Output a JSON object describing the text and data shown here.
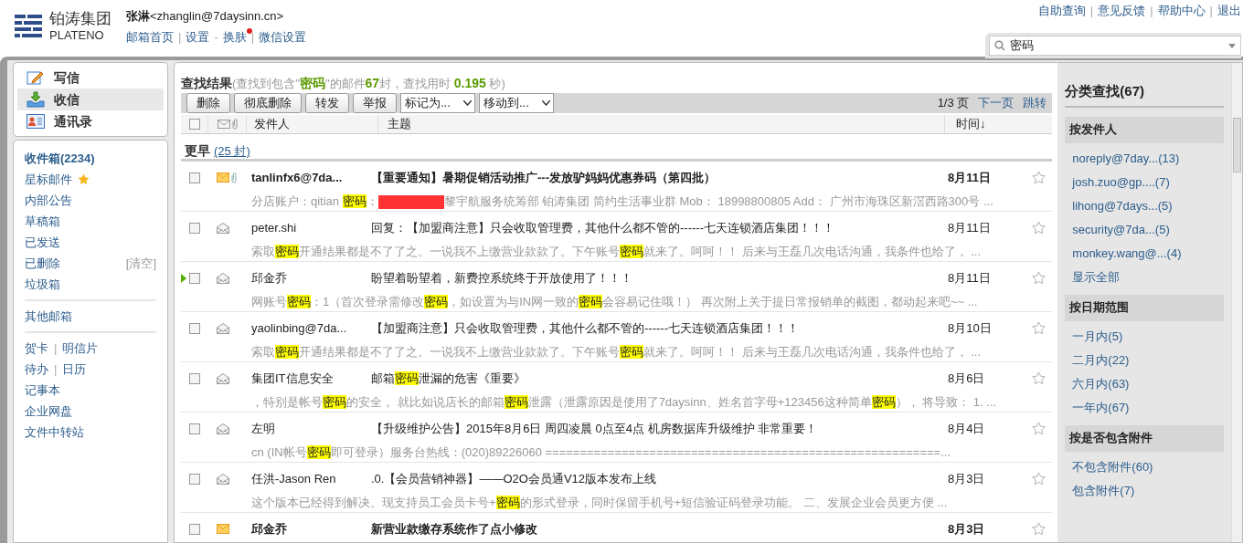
{
  "header": {
    "brand_cn": "铂涛集团",
    "brand_en": "PLATENO",
    "user_name": "张淋",
    "user_email": "<zhanglin@7daysinn.cn>",
    "links": [
      {
        "kind": "link",
        "label": "邮箱首页",
        "badge": false
      },
      {
        "kind": "separator",
        "label": "|"
      },
      {
        "kind": "link",
        "label": "设置",
        "badge": false
      },
      {
        "kind": "separator",
        "label": "-"
      },
      {
        "kind": "link",
        "label": "换肤",
        "badge": true
      },
      {
        "kind": "separator",
        "label": "|"
      },
      {
        "kind": "link",
        "label": "微信设置",
        "badge": false
      }
    ],
    "top_links": [
      {
        "kind": "link",
        "label": "自助查询"
      },
      {
        "kind": "separator",
        "label": "|"
      },
      {
        "kind": "link",
        "label": "意见反馈"
      },
      {
        "kind": "separator",
        "label": "|"
      },
      {
        "kind": "link",
        "label": "帮助中心"
      },
      {
        "kind": "separator",
        "label": "|"
      },
      {
        "kind": "link",
        "label": "退出"
      }
    ],
    "search": {
      "value": "密码"
    }
  },
  "nav": [
    {
      "label": "写信",
      "kind": "compose",
      "selected": false
    },
    {
      "label": "收信",
      "kind": "inbox",
      "selected": true
    },
    {
      "label": "通讯录",
      "kind": "contacts",
      "selected": false
    }
  ],
  "folder_groups": [
    [
      {
        "label": "收件箱(2234)",
        "kind": "bold"
      },
      {
        "label": "星标邮件",
        "kind": "starred"
      },
      {
        "label": "内部公告",
        "kind": "plain"
      },
      {
        "label": "草稿箱",
        "kind": "plain"
      },
      {
        "label": "已发送",
        "kind": "plain"
      },
      {
        "label": "已删除",
        "kind": "plain",
        "action": "[清空]"
      },
      {
        "label": "垃圾箱",
        "kind": "plain"
      }
    ],
    [
      {
        "label": "其他邮箱",
        "kind": "plain"
      }
    ],
    [
      {
        "links": [
          {
            "kind": "link",
            "label": "贺卡"
          },
          {
            "kind": "separator",
            "label": "|"
          },
          {
            "kind": "link",
            "label": "明信片"
          }
        ]
      },
      {
        "links": [
          {
            "kind": "link",
            "label": "待办"
          },
          {
            "kind": "separator",
            "label": "|"
          },
          {
            "kind": "link",
            "label": "日历"
          }
        ]
      },
      {
        "label": "记事本",
        "kind": "plain"
      },
      {
        "label": "企业网盘",
        "kind": "plain"
      },
      {
        "label": "文件中转站",
        "kind": "plain"
      }
    ]
  ],
  "results": {
    "title": "查找结果",
    "summary": "(查找到包含\"**密码**\"的邮件**67**封，查找用时 **0.195** 秒)"
  },
  "toolbar": {
    "buttons": [
      "删除",
      "彻底删除",
      "转发",
      "举报"
    ],
    "dropdowns": [
      "标记为...",
      "移动到..."
    ],
    "page": "1/3 页",
    "next": "下一页",
    "jump": "跳转"
  },
  "select_all": {
    "checked": false
  },
  "columns": [
    "发件人",
    "主题",
    "时间↓"
  ],
  "group": {
    "label": "更早",
    "count": "(25 封)"
  },
  "rows": [
    {
      "checked": false,
      "unread": true,
      "attachment": true,
      "current": false,
      "starred": false,
      "sender": "tanlinfx6@7da...",
      "subject": [
        {
          "text": "【重要通知】暑期促销活动推广---发放驴妈妈优惠券码（第四批）",
          "kind": "text"
        }
      ],
      "date": "8月11日",
      "preview": [
        {
          "text": "分店账户：qitian ",
          "kind": "text"
        },
        {
          "text": "密码",
          "kind": "highlight"
        },
        {
          "text": "：",
          "kind": "text"
        },
        {
          "kind": "redaction"
        },
        {
          "text": "黎宇航服务统筹部 铂涛集团 简约生活事业群 Mob： 18998800805 Add： 广州市海珠区新滘西路300号 ...",
          "kind": "text"
        }
      ]
    },
    {
      "checked": false,
      "unread": false,
      "attachment": false,
      "current": false,
      "starred": false,
      "sender": "peter.shi",
      "subject": [
        {
          "text": "回复：【加盟商注意】只会收取管理费，其他什么都不管的------七天连锁酒店集团！！！",
          "kind": "text"
        }
      ],
      "date": "8月11日",
      "preview": [
        {
          "text": "索取",
          "kind": "text"
        },
        {
          "text": "密码",
          "kind": "highlight"
        },
        {
          "text": "开通结果都是不了了之。一说我不上缴营业款款了。下午账号",
          "kind": "text"
        },
        {
          "text": "密码",
          "kind": "highlight"
        },
        {
          "text": "就来了。呵呵！！ 后来与王磊几次电话沟通，我条件也给了， ...",
          "kind": "text"
        }
      ]
    },
    {
      "checked": false,
      "unread": false,
      "attachment": false,
      "current": true,
      "starred": false,
      "sender": "邱金乔",
      "subject": [
        {
          "text": "盼望着盼望着，新费控系统终于开放使用了！！！",
          "kind": "text"
        }
      ],
      "date": "8月11日",
      "preview": [
        {
          "text": "网账号",
          "kind": "text"
        },
        {
          "text": "密码",
          "kind": "highlight"
        },
        {
          "text": "：1（首次登录需修改",
          "kind": "text"
        },
        {
          "text": "密码",
          "kind": "highlight"
        },
        {
          "text": "，如设置为与IN网一致的",
          "kind": "text"
        },
        {
          "text": "密码",
          "kind": "highlight"
        },
        {
          "text": "会容易记住哦！） 再次附上关于提日常报销单的截图，都动起来吧~~ ...",
          "kind": "text"
        }
      ]
    },
    {
      "checked": false,
      "unread": false,
      "attachment": false,
      "current": false,
      "starred": false,
      "sender": "yaolinbing@7da...",
      "subject": [
        {
          "text": "【加盟商注意】只会收取管理费，其他什么都不管的------七天连锁酒店集团！！！",
          "kind": "text"
        }
      ],
      "date": "8月10日",
      "preview": [
        {
          "text": "索取",
          "kind": "text"
        },
        {
          "text": "密码",
          "kind": "highlight"
        },
        {
          "text": "开通结果都是不了了之。一说我不上缴营业款款了。下午账号",
          "kind": "text"
        },
        {
          "text": "密码",
          "kind": "highlight"
        },
        {
          "text": "就来了。呵呵！！ 后来与王磊几次电话沟通，我条件也给了， ...",
          "kind": "text"
        }
      ]
    },
    {
      "checked": false,
      "unread": false,
      "attachment": false,
      "current": false,
      "starred": false,
      "sender": "集团IT信息安全",
      "subject": [
        {
          "text": "邮箱",
          "kind": "text"
        },
        {
          "text": "密码",
          "kind": "highlight"
        },
        {
          "text": "泄漏的危害《重要》",
          "kind": "text"
        }
      ],
      "date": "8月6日",
      "preview": [
        {
          "text": "，特别是帐号",
          "kind": "text"
        },
        {
          "text": "密码",
          "kind": "highlight"
        },
        {
          "text": "的安全， 就比如说店长的邮箱",
          "kind": "text"
        },
        {
          "text": "密码",
          "kind": "highlight"
        },
        {
          "text": "泄露（泄露原因是使用了7daysinn、姓名首字母+123456这种简单",
          "kind": "text"
        },
        {
          "text": "密码",
          "kind": "highlight"
        },
        {
          "text": "）， 将导致： 1. ...",
          "kind": "text"
        }
      ]
    },
    {
      "checked": false,
      "unread": false,
      "attachment": false,
      "current": false,
      "starred": false,
      "sender": "左明",
      "subject": [
        {
          "text": "【升级维护公告】2015年8月6日 周四凌晨 0点至4点 机房数据库升级维护 非常重要！",
          "kind": "text"
        }
      ],
      "date": "8月4日",
      "preview": [
        {
          "text": "cn (IN帐号",
          "kind": "text"
        },
        {
          "text": "密码",
          "kind": "highlight"
        },
        {
          "text": "即可登录）服务台热线：(020)89226060 =========================================================...",
          "kind": "text"
        }
      ]
    },
    {
      "checked": false,
      "unread": false,
      "attachment": false,
      "current": false,
      "starred": false,
      "sender": "任洪-Jason Ren",
      "subject": [
        {
          "text": ".0.【会员营销神器】——O2O会员通V12版本发布上线",
          "kind": "text"
        }
      ],
      "date": "8月3日",
      "preview": [
        {
          "text": "这个版本已经得到解决。现支持员工会员卡号+",
          "kind": "text"
        },
        {
          "text": "密码",
          "kind": "highlight"
        },
        {
          "text": "的形式登录，同时保留手机号+短信验证码登录功能。 二、发展企业会员更方便 ...",
          "kind": "text"
        }
      ]
    },
    {
      "checked": false,
      "unread": true,
      "attachment": false,
      "current": false,
      "starred": false,
      "sender": "邱金乔",
      "subject": [
        {
          "text": "新营业款缴存系统作了点小修改",
          "kind": "text"
        }
      ],
      "date": "8月3日",
      "preview": []
    }
  ],
  "filter": {
    "title": "分类查找(67)",
    "sections": [
      {
        "heading": "按发件人",
        "items": [
          "noreply@7day...(13)",
          "josh.zuo@gp....(7)",
          "lihong@7days...(5)",
          "security@7da...(5)",
          "monkey.wang@...(4)",
          "显示全部"
        ]
      },
      {
        "heading": "按日期范围",
        "items": [
          "一月内(5)",
          "二月内(22)",
          "六月内(63)",
          "一年内(67)"
        ]
      },
      {
        "heading": "按是否包含附件",
        "items": [
          "不包含附件(60)",
          "包含附件(7)"
        ]
      }
    ]
  }
}
